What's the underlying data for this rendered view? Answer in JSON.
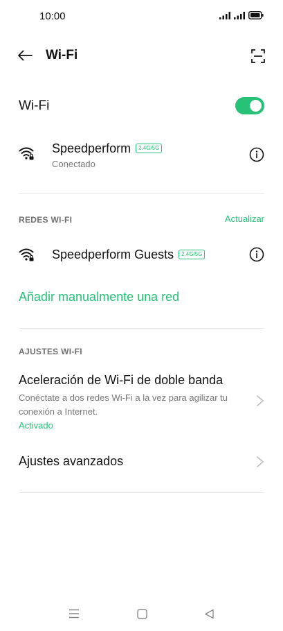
{
  "status_bar": {
    "time": "10:00"
  },
  "header": {
    "title": "Wi-Fi"
  },
  "wifi_toggle": {
    "label": "Wi-Fi",
    "enabled": true
  },
  "connected_network": {
    "name": "Speedperform",
    "band": "2.4G/5G",
    "status": "Conectado"
  },
  "networks_section": {
    "title": "REDES WI-FI",
    "refresh_label": "Actualizar",
    "networks": [
      {
        "name": "Speedperform Guests",
        "band": "2.4G/5G"
      }
    ],
    "add_manual_label": "Añadir manualmente una red"
  },
  "settings_section": {
    "title": "AJUSTES WI-FI",
    "dual_band": {
      "title": "Aceleración de Wi-Fi de doble banda",
      "description": "Conéctate a dos redes Wi-Fi a la vez para agilizar tu conexión a Internet.",
      "status": "Activado"
    },
    "advanced": {
      "title": "Ajustes avanzados"
    }
  },
  "colors": {
    "accent": "#27c177",
    "text_primary": "#111111",
    "text_secondary": "#777777",
    "divider": "#e6e6e6"
  },
  "icons": {
    "back": "arrow-left-icon",
    "scan": "qr-scan-icon",
    "wifi": "wifi-lock-icon",
    "info": "info-icon",
    "chevron": "chevron-right-icon",
    "nav_menu": "menu-icon",
    "nav_home": "home-square-icon",
    "nav_back": "back-triangle-icon"
  }
}
